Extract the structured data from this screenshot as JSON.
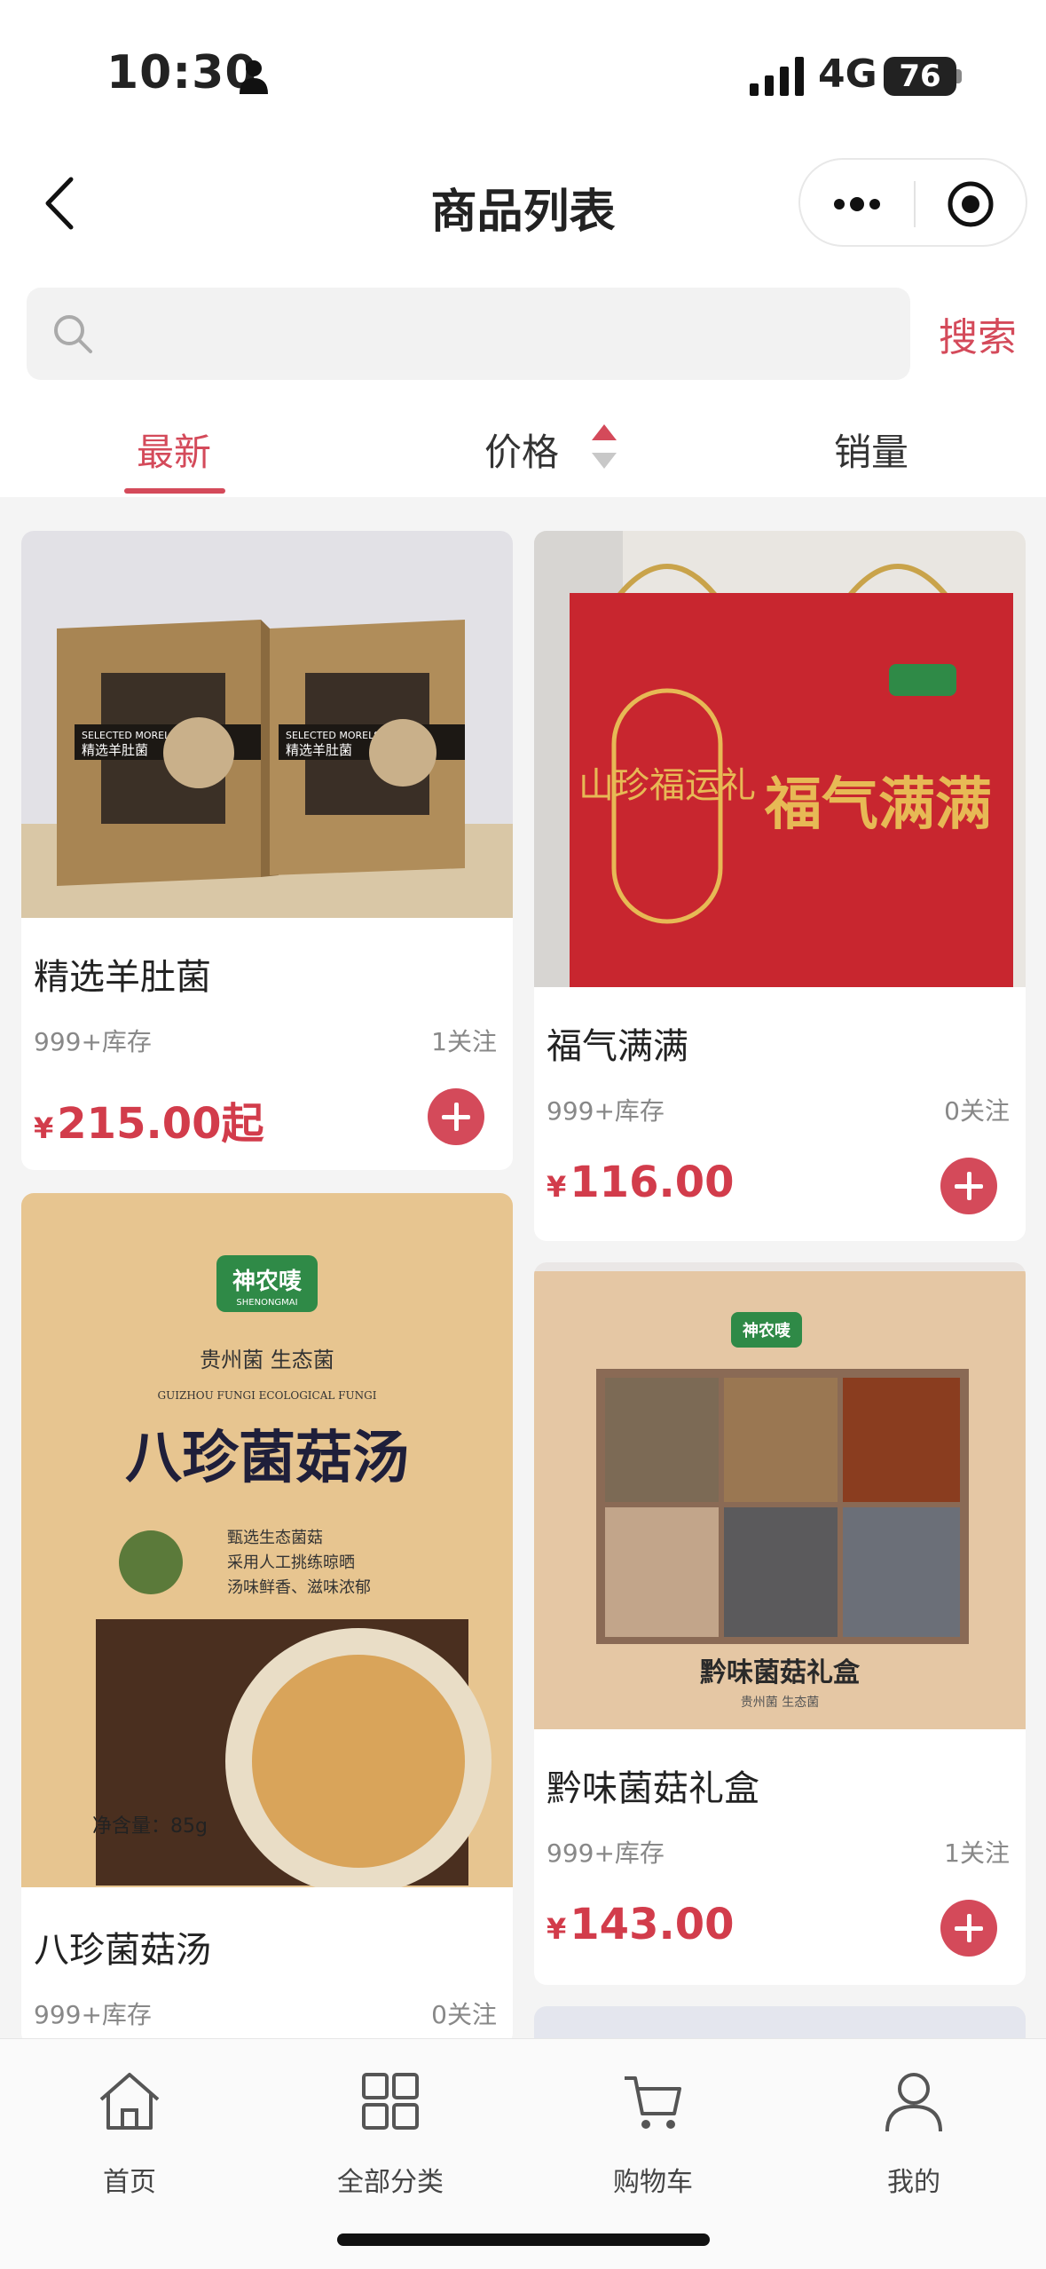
{
  "status_bar": {
    "time": "10:30",
    "network": "4G",
    "battery": "76"
  },
  "nav": {
    "title": "商品列表"
  },
  "search": {
    "placeholder": "",
    "button_label": "搜索"
  },
  "sort_tabs": [
    {
      "label": "最新",
      "active": true
    },
    {
      "label": "价格",
      "active": false
    },
    {
      "label": "销量",
      "active": false
    }
  ],
  "products": [
    {
      "name": "精选羊肚菌",
      "stock": "999+库存",
      "follows": "1关注",
      "currency": "¥",
      "price": "215.00起"
    },
    {
      "name": "福气满满",
      "stock": "999+库存",
      "follows": "0关注",
      "currency": "¥",
      "price": "116.00"
    },
    {
      "name": "八珍菌菇汤",
      "stock": "999+库存",
      "follows": "0关注",
      "currency": "¥",
      "price": ""
    },
    {
      "name": "黔味菌菇礼盒",
      "stock": "999+库存",
      "follows": "1关注",
      "currency": "¥",
      "price": "143.00"
    }
  ],
  "image_text": {
    "p1_box_en": "SELECTED MORELS",
    "p1_box_cn": "精选羊肚菌",
    "p2_bag_main": "福气满满",
    "p2_bag_emblem": "山珍福运礼",
    "p3_brand": "神农唛",
    "p3_brand_en": "SHENONGMAI",
    "p3_sub": "贵州菌 生态菌",
    "p3_sub_en": "GUIZHOU FUNGI ECOLOGICAL FUNGI",
    "p3_title": "八珍菌菇汤",
    "p3_bullet1": "甄选生态菌菇",
    "p3_bullet2": "采用人工挑练晾晒",
    "p3_bullet3": "汤味鲜香、滋味浓郁",
    "p3_net": "净含量：85g",
    "p4_brand": "神农唛",
    "p4_title": "黔味菌菇礼盒",
    "p4_sub": "贵州菌 生态菌"
  },
  "tabbar": [
    {
      "label": "首页",
      "icon": "home-icon"
    },
    {
      "label": "全部分类",
      "icon": "grid-icon"
    },
    {
      "label": "购物车",
      "icon": "cart-icon"
    },
    {
      "label": "我的",
      "icon": "user-icon"
    }
  ],
  "colors": {
    "accent": "#d44a5a",
    "price": "#d23c4b",
    "background": "#f4f4f4"
  }
}
